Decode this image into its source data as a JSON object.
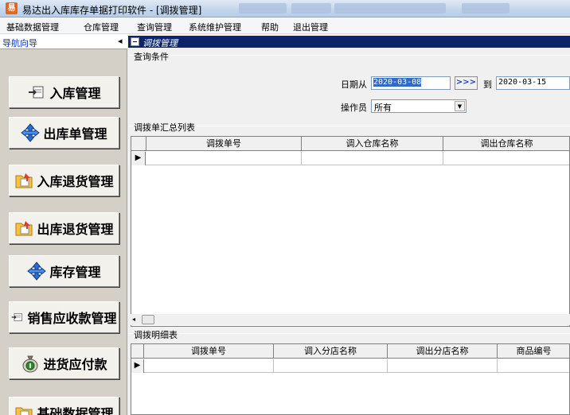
{
  "window": {
    "title": "易达出入库库存单据打印软件  - [调拨管理]",
    "app_icon_glyph": "易"
  },
  "menu": [
    "基础数据管理",
    "仓库管理",
    "查询管理",
    "系统维护管理",
    "帮助",
    "退出管理"
  ],
  "nav": {
    "header": "导航向导",
    "collapse_glyph": "◂",
    "items": [
      {
        "label": "入库管理",
        "icon": "inbound-doc-icon"
      },
      {
        "label": "出库单管理",
        "icon": "outbound-arrows-icon"
      },
      {
        "label": "入库退货管理",
        "icon": "inbound-return-folder-icon"
      },
      {
        "label": "出库退货管理",
        "icon": "outbound-return-folder-icon"
      },
      {
        "label": "库存管理",
        "icon": "inventory-arrows-icon"
      },
      {
        "label": "销售应收款管理",
        "icon": "receivables-doc-icon"
      },
      {
        "label": "进货应付款",
        "icon": "money-bag-icon"
      },
      {
        "label": "基础数据管理",
        "icon": "base-data-folder-icon"
      }
    ]
  },
  "panel": {
    "title": "调拨管理",
    "query_group": "查询条件",
    "date_from_label": "日期从",
    "date_from": "2020-03-08",
    "next_button": ">>>",
    "to_label": "到",
    "date_to": "2020-03-15",
    "operator_label": "操作员",
    "operator_value": "所有"
  },
  "summary_grid": {
    "title": "调拨单汇总列表",
    "columns": [
      "调拨单号",
      "调入仓库名称",
      "调出仓库名称"
    ],
    "row_indicator": "▶"
  },
  "detail_grid": {
    "title": "调拨明细表",
    "columns": [
      "调拨单号",
      "调入分店名称",
      "调出分店名称",
      "商品编号"
    ],
    "row_indicator": "▶"
  },
  "scroll": {
    "left_arrow": "◂"
  },
  "colors": {
    "title_bar": "#c4d5ea",
    "panel_title": "#0b246a",
    "nav_bg": "#d4d0c8",
    "selection": "#316ac5"
  }
}
